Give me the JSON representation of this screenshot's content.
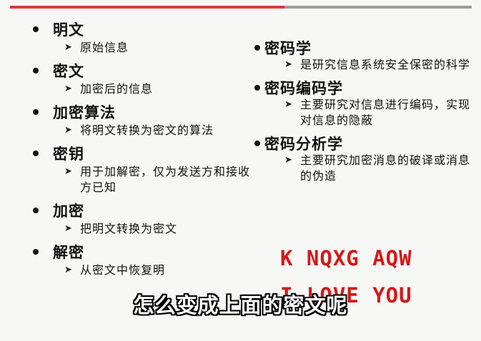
{
  "left_terms": [
    {
      "term": "明文",
      "desc": "原始信息"
    },
    {
      "term": "密文",
      "desc": "加密后的信息"
    },
    {
      "term": "加密算法",
      "desc": "将明文转换为密文的算法"
    },
    {
      "term": "密钥",
      "desc": "用于加解密，仅为发送方和接收方已知"
    },
    {
      "term": "加密",
      "desc": "把明文转换为密文"
    },
    {
      "term": "解密",
      "desc": "从密文中恢复明"
    }
  ],
  "right_terms": [
    {
      "term": "密码学",
      "desc": "是研究信息系统安全保密的科学"
    },
    {
      "term": "密码编码学",
      "desc": "主要研究对信息进行编码，实现对信息的隐蔽"
    },
    {
      "term": "密码分析学",
      "desc": "主要研究加密消息的破译或消息的伪造"
    }
  ],
  "cipher_example": {
    "ciphertext": "K NQXG AQW",
    "plaintext": "I LOVE YOU"
  },
  "caption": "怎么变成上面的密文呢",
  "colors": {
    "accent_red": "#d21919",
    "top_bar_red": "#d93a3a",
    "top_bar_gray": "#9b9b9b"
  }
}
